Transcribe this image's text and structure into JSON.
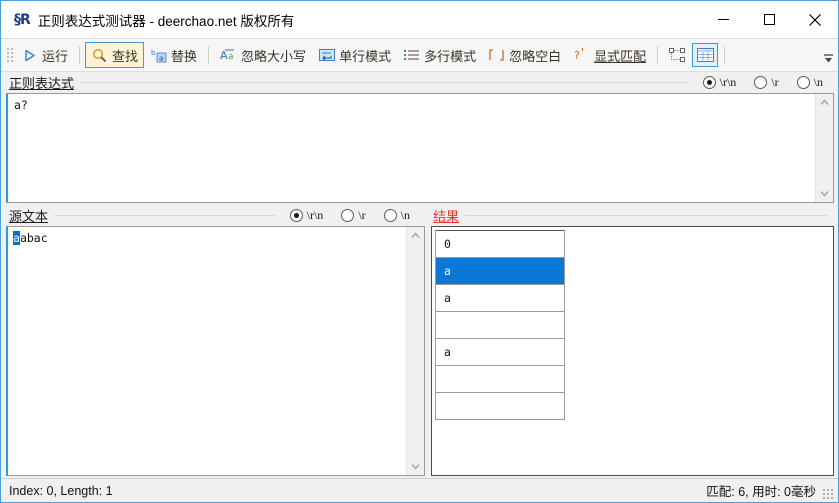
{
  "window": {
    "title": "正则表达式测试器 - deerchao.net 版权所有",
    "app_icon": "regex-app-icon",
    "minimize_label": "—",
    "maximize_label": "□",
    "close_label": "✕",
    "accent_border": "#4a9fd8"
  },
  "toolbar": {
    "run_label": "运行",
    "find_label": "查找",
    "replace_label": "替换",
    "ignore_case_label": "忽略大小写",
    "singleline_label": "单行模式",
    "multiline_label": "多行模式",
    "ignore_whitespace_label": "忽略空白",
    "explicit_capture_label": "显式匹配",
    "tree_view_icon": "tree-nodes-icon",
    "grid_view_icon": "grid-table-icon",
    "overflow_label": "▼",
    "active_button": "查找",
    "active_bg": "#fdf4d8",
    "active_border": "#3c9dd8",
    "text_color": "#3a3226"
  },
  "regex_section": {
    "title": "正则表达式",
    "value": "a?",
    "newline_options": [
      {
        "label": "\\r\\n",
        "selected": true
      },
      {
        "label": "\\r",
        "selected": false
      },
      {
        "label": "\\n",
        "selected": false
      }
    ]
  },
  "source_section": {
    "title": "源文本",
    "value": "aabac",
    "selected_text": "a",
    "rest_text": "abac",
    "selection_color": "#0a6fc2",
    "newline_options": [
      {
        "label": "\\r\\n",
        "selected": true
      },
      {
        "label": "\\r",
        "selected": false
      },
      {
        "label": "\\n",
        "selected": false
      }
    ]
  },
  "result_section": {
    "title": "结果",
    "title_color": "#e8342a",
    "selection_color": "#0a78d4",
    "rows": [
      {
        "text": "0",
        "selected": false,
        "header": true
      },
      {
        "text": "a",
        "selected": true,
        "header": false
      },
      {
        "text": "a",
        "selected": false,
        "header": false
      },
      {
        "text": "",
        "selected": false,
        "header": false
      },
      {
        "text": "a",
        "selected": false,
        "header": false
      },
      {
        "text": "",
        "selected": false,
        "header": false
      },
      {
        "text": "",
        "selected": false,
        "header": false
      }
    ]
  },
  "statusbar": {
    "left_text": "Index: 0, Length: 1",
    "right_text": "匹配:   6, 用时: 0毫秒"
  }
}
